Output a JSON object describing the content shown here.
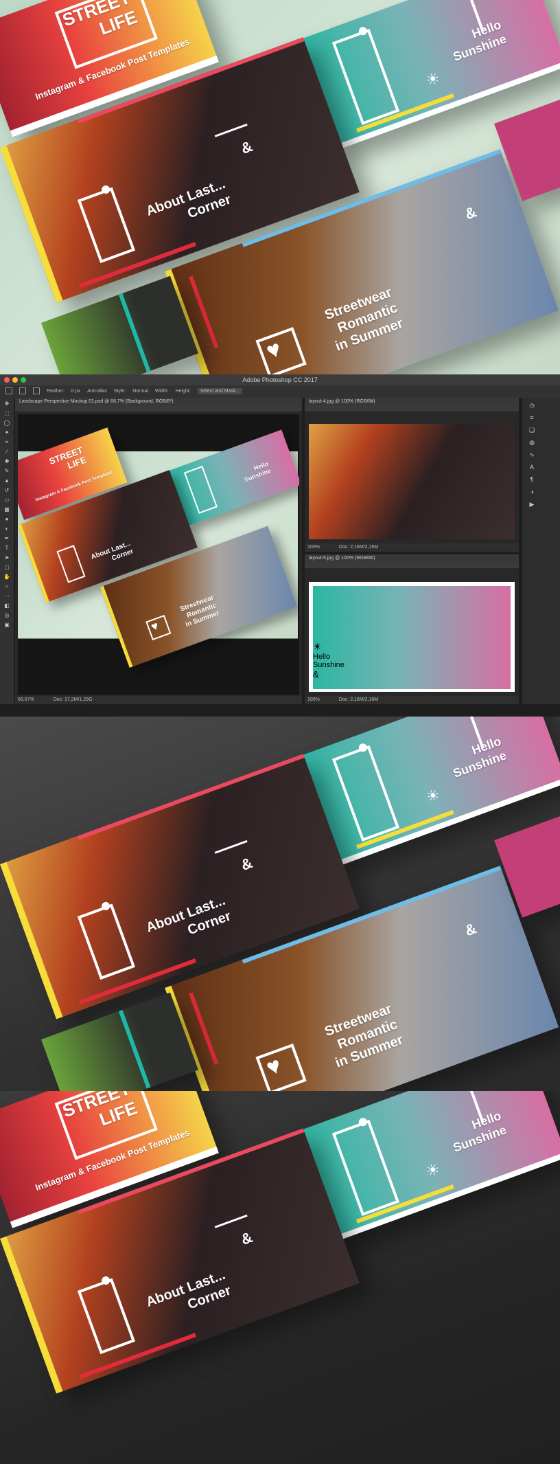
{
  "mockup": {
    "card_street": {
      "line1": "STREET",
      "line2": "LIFE",
      "subtitle": "Instagram & Facebook Post Templates"
    },
    "card_corner": {
      "line1": "About Last...",
      "line2": "Corner",
      "amp": "&"
    },
    "card_sunshine": {
      "line1": "Hello",
      "line2": "Sunshine"
    },
    "card_streetwear": {
      "line1": "Streetwear",
      "line2": "Romantic",
      "line3": "in Summer",
      "amp": "&"
    }
  },
  "photoshop": {
    "app_title": "Adobe Photoshop CC 2017",
    "options": {
      "feather_label": "Feather:",
      "feather_value": "0 px",
      "antialias": "Anti-alias",
      "style_label": "Style:",
      "style_value": "Normal",
      "width_label": "Width:",
      "height_label": "Height:",
      "select_mask": "Select and Mask..."
    },
    "doc_main": {
      "tab": "Landscape Perspective Mockup 01.psd @ 66,7% (Background, RGB/8*)",
      "zoom": "66,67%",
      "doc_size": "Doc: 17,2M/1,29G"
    },
    "doc_layout4": {
      "tab": "layout-4.jpg @ 100% (RGB/8#)",
      "zoom": "100%",
      "doc_size": "Doc: 2,16M/2,16M"
    },
    "doc_layout5": {
      "tab": "layout-5.jpg @ 100% (RGB/8#)",
      "zoom": "100%",
      "doc_size": "Doc: 2,16M/2,16M"
    }
  },
  "colors": {
    "accent_yellow": "#f6dd3c",
    "accent_red": "#e22b3a",
    "accent_cyan": "#1fb7a6",
    "ps_dark": "#1e1e1e"
  }
}
